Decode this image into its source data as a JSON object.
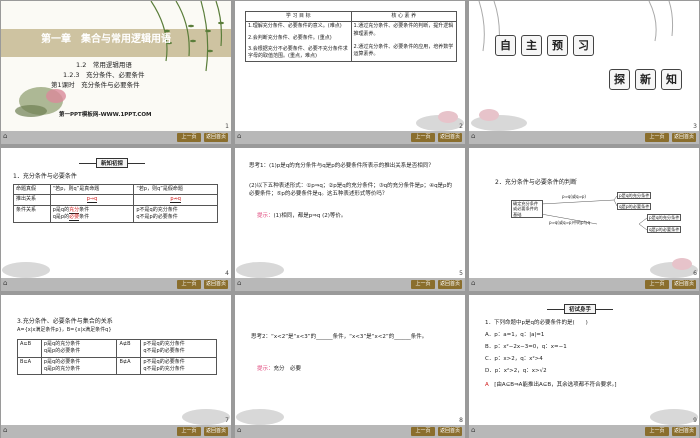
{
  "footer": {
    "home_icon": "home-icon",
    "btn1": "上一页",
    "btn2": "返回首页"
  },
  "slide1": {
    "chapter": "第一章　集合与常用逻辑用语",
    "sec1": "1.2　常用逻辑用语",
    "sec2": "1.2.3　充分条件、必要条件",
    "sec3": "第1课时　充分条件与必要条件",
    "brand": "第一PPT模板网-WWW.1PPT.COM",
    "page": "1"
  },
  "slide2": {
    "h1": "学 习 目 标",
    "h2": "核 心 素 养",
    "left": [
      "1.理解充分条件、必要条件的意义。(难点)",
      "2.会判断充分条件、必要条件。(重点)",
      "3.会根据充分不必要条件、必要不充分条件求字母的取值范围。(重点，难点)"
    ],
    "right": [
      "1.通过充分条件、必要条件的判断，提升逻辑推理素养。",
      "2.通过充分条件、必要条件的应用，培养数学运算素养。"
    ],
    "page": "2"
  },
  "slide3": {
    "chars1": [
      "自",
      "主",
      "预",
      "习"
    ],
    "chars2": [
      "探",
      "新",
      "知"
    ],
    "page": "3"
  },
  "slide4": {
    "tag": "新知初探",
    "title": "1．充分条件与必要条件",
    "r1c1": "命题真假",
    "r1c2": "“若p，则q”是真命题",
    "r1c3": "“若p，则q”是假命题",
    "r2c1": "推出关系",
    "r2c2": "p⇒q",
    "r2c3": "p⇏q",
    "r3c1": "条件关系",
    "r3c2a": "p是q的",
    "r3c2a_ans": "充分",
    "r3c2a_end": "条件",
    "r3c2b": "q是p的",
    "r3c2b_ans": "必要",
    "r3c2b_end": "条件",
    "r3c3a": "p不是q的充分条件",
    "r3c3b": "q不是p的必要条件",
    "page": "4"
  },
  "slide5": {
    "l1": "思考1：(1)p是q的充分条件与q是p的必要条件所表示的推出关系是否相同？",
    "l2": "(2)以下五种表述形式：①p⇒q；②p是q的充分条件；③q的充分条件是p；④q是p的必要条件；⑤p的必要条件是q。这五种表述形式等价吗？",
    "hint_label": "提示：",
    "hint": "(1)相同，都是p⇒q (2)等价。",
    "page": "5"
  },
  "slide6": {
    "title": "2．充分条件与必要条件的判断",
    "root": "确定充分条件或必要条件的基础",
    "arrow_top": "p⇒q(或q⇒p)",
    "arrow_bottom": "p⇒q(或q⇒p)中的p与q",
    "b1": "p是q的充分条件",
    "b2": "q是p的必要条件",
    "b3": "p是q的充分条件",
    "b4": "q是p的必要条件",
    "page": "6"
  },
  "slide7": {
    "title": "3.充分条件、必要条件与集合的关系",
    "sets": "A={x|x满足条件p}，B={x|x满足条件q}",
    "c1": "A⊆B",
    "c2a": "p是q的充分条件",
    "c2b": "q是p的必要条件",
    "c3": "A⊈B",
    "c4a": "p不是q的充分条件",
    "c4b": "q不是p的必要条件",
    "c5": "B⊆A",
    "c6a": "p是q的必要条件",
    "c6b": "q是p的充分条件",
    "c7": "B⊈A",
    "c8a": "p不是q的必要条件",
    "c8b": "q不是p的充分条件",
    "page": "7"
  },
  "slide8": {
    "l1": "思考2：“x<2”是“x<3”的______条件，“x<3”是“x<2”的______条件。",
    "hint_label": "提示：",
    "hint": "充分　必要",
    "page": "8"
  },
  "slide9": {
    "tag": "初试身手",
    "q": "1．下列命题中p是q的必要条件的是(　　)",
    "a": "A．p：a=1，q：|a|=1",
    "b": "B．p：x²−2x−3=0，q：x=−1",
    "c": "C．p：x>2，q：x²>4",
    "d": "D．p：x²>2，q：x>√2",
    "ans": "A",
    "explain": "[由A⊆B⇒A能推出A⊆B，其余选项都不符合要求。]",
    "page": "9"
  }
}
